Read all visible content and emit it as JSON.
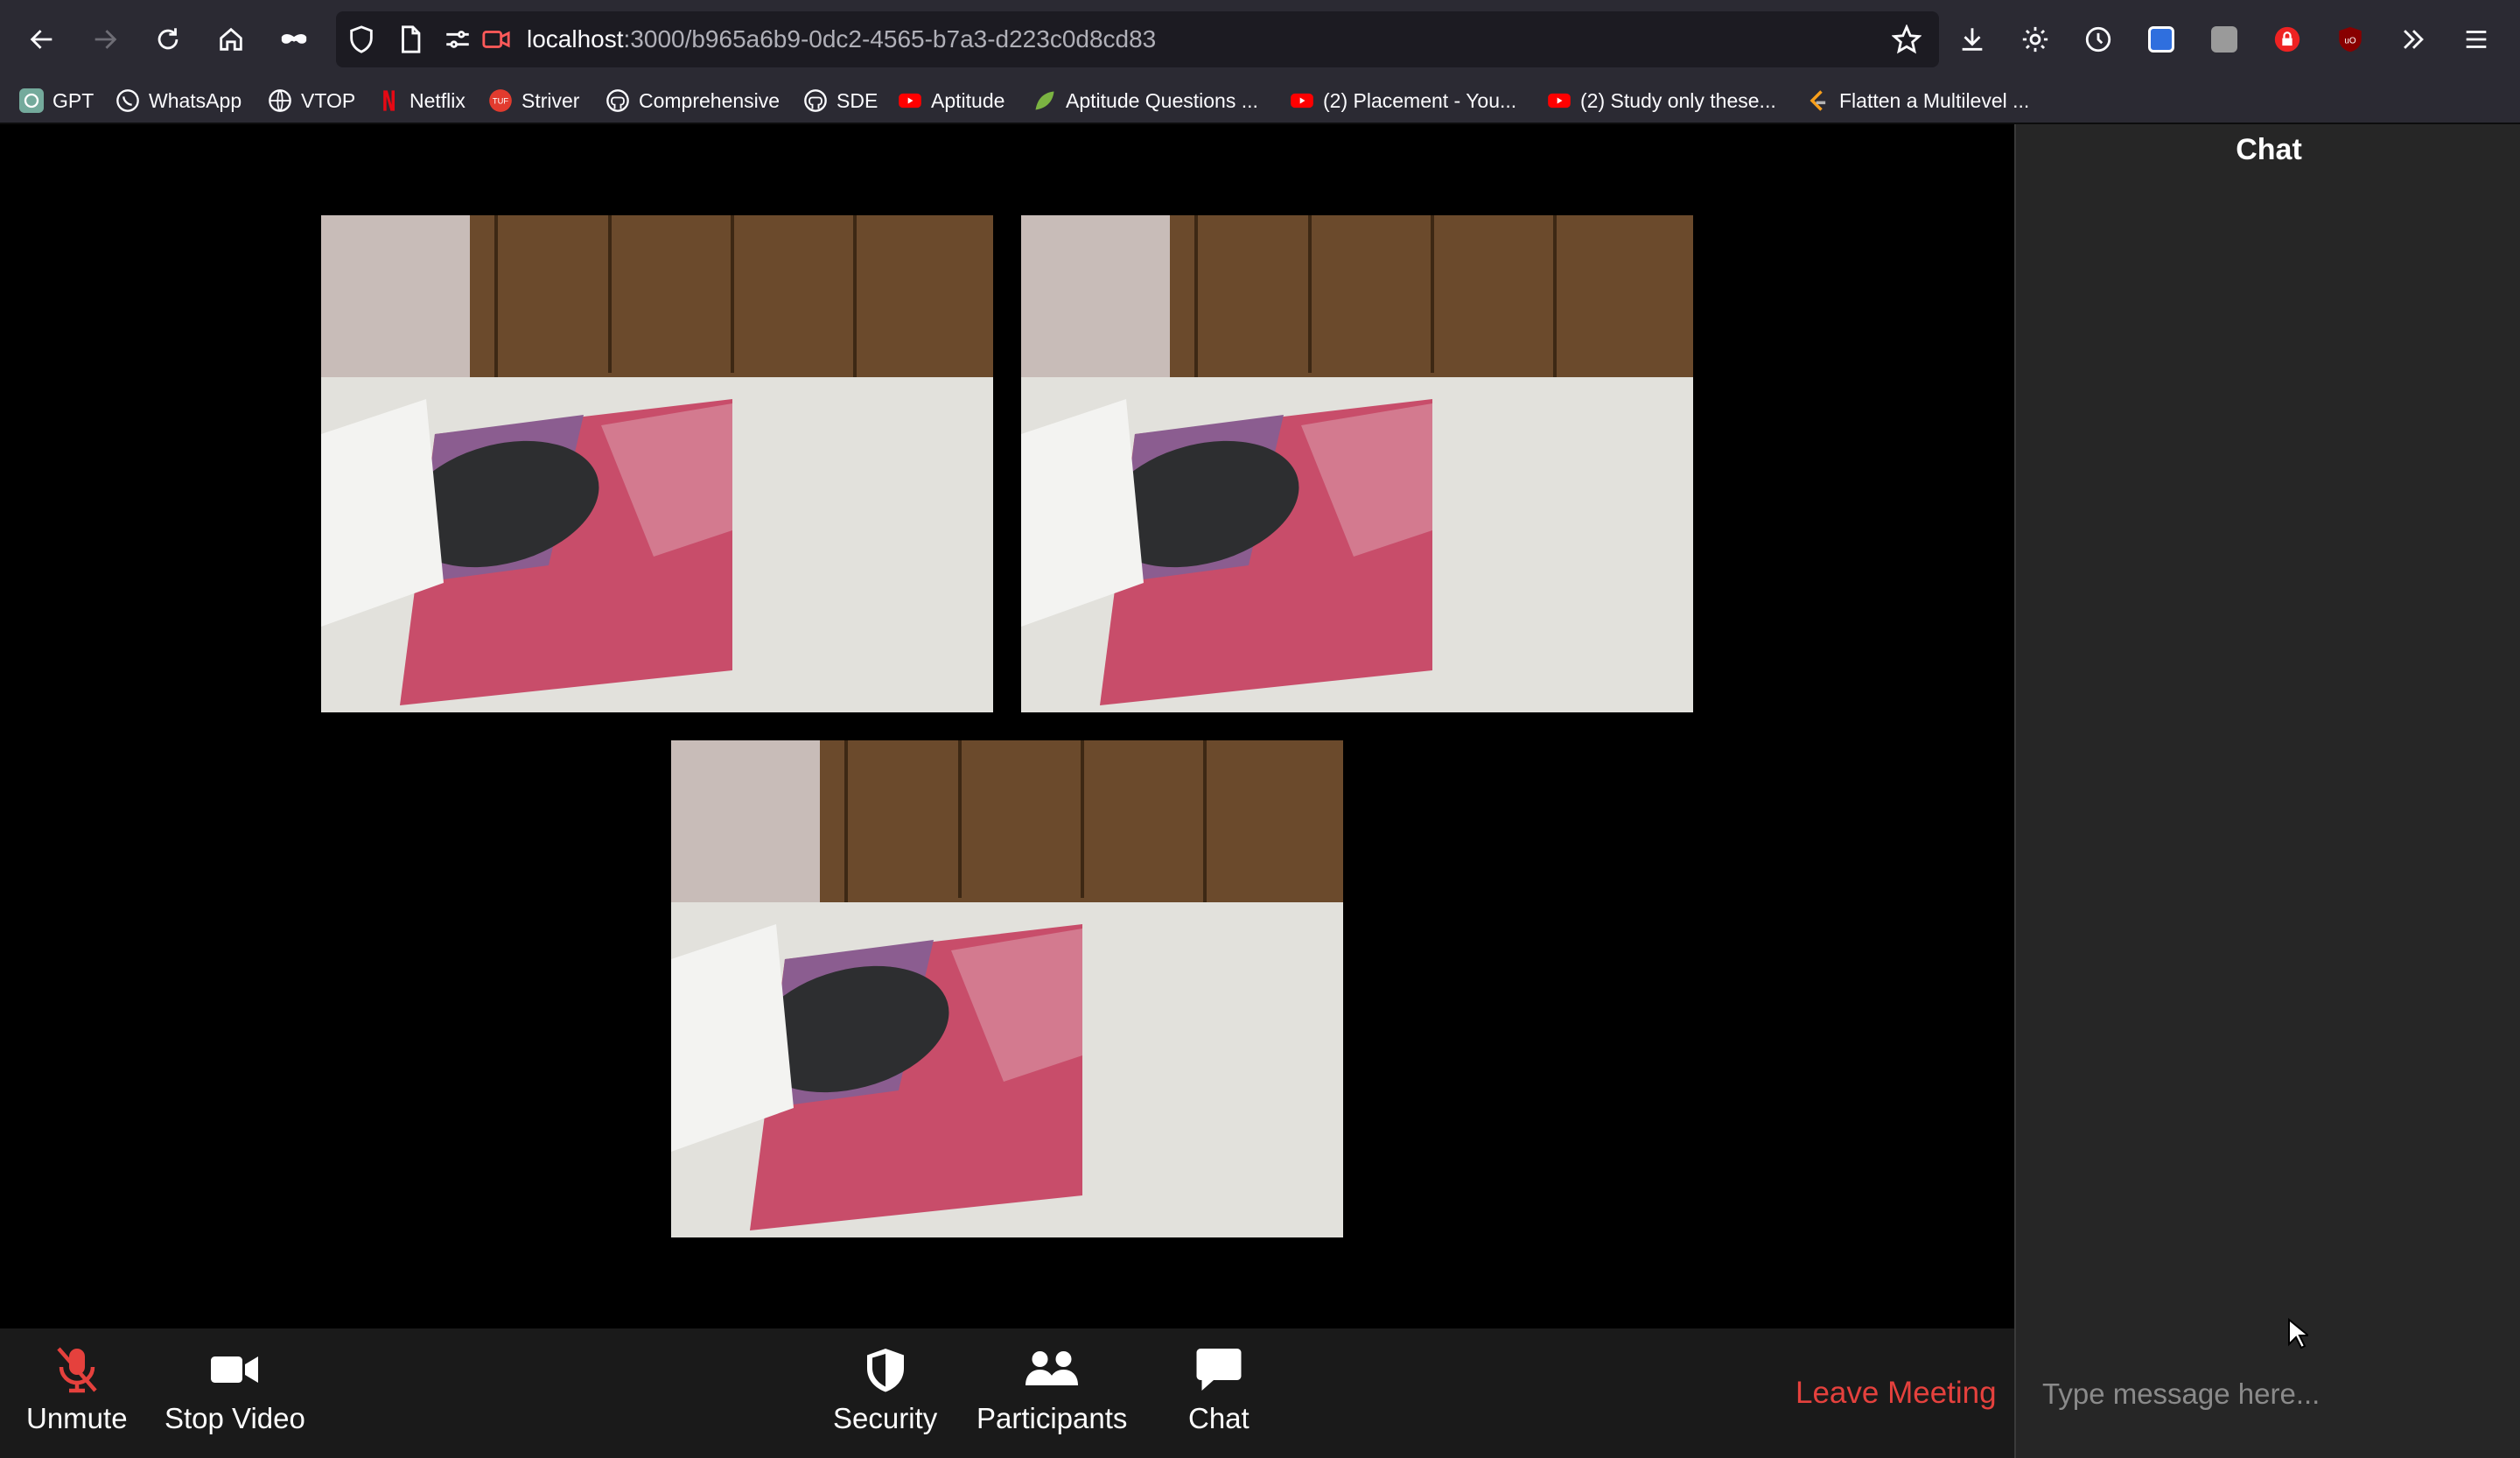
{
  "browser": {
    "url_host": "localhost",
    "url_path": ":3000/b965a6b9-0dc2-4565-b7a3-d223c0d8cd83",
    "bookmarks": [
      {
        "label": "GPT",
        "icon": "openai-icon"
      },
      {
        "label": "WhatsApp",
        "icon": "whatsapp-icon"
      },
      {
        "label": "VTOP",
        "icon": "globe-icon"
      },
      {
        "label": "Netflix",
        "icon": "netflix-icon"
      },
      {
        "label": "Striver",
        "icon": "tuf-icon"
      },
      {
        "label": "Comprehensive",
        "icon": "github-icon"
      },
      {
        "label": "SDE",
        "icon": "github-icon"
      },
      {
        "label": "Aptitude",
        "icon": "youtube-icon"
      },
      {
        "label": "Aptitude Questions ...",
        "icon": "leaf-icon"
      },
      {
        "label": "(2) Placement - You...",
        "icon": "youtube-icon"
      },
      {
        "label": "(2) Study only these...",
        "icon": "youtube-icon"
      },
      {
        "label": "Flatten a Multilevel ...",
        "icon": "leetcode-icon"
      }
    ]
  },
  "meeting": {
    "controls": {
      "unmute": "Unmute",
      "stop_video": "Stop Video",
      "security": "Security",
      "participants": "Participants",
      "chat": "Chat",
      "leave": "Leave Meeting"
    }
  },
  "chat": {
    "title": "Chat",
    "input_placeholder": "Type message here..."
  },
  "colors": {
    "leave": "#e5413d",
    "muted_mic": "#e5413d",
    "chat_panel_bg": "#262626",
    "controls_bg": "#1a1a1a"
  }
}
